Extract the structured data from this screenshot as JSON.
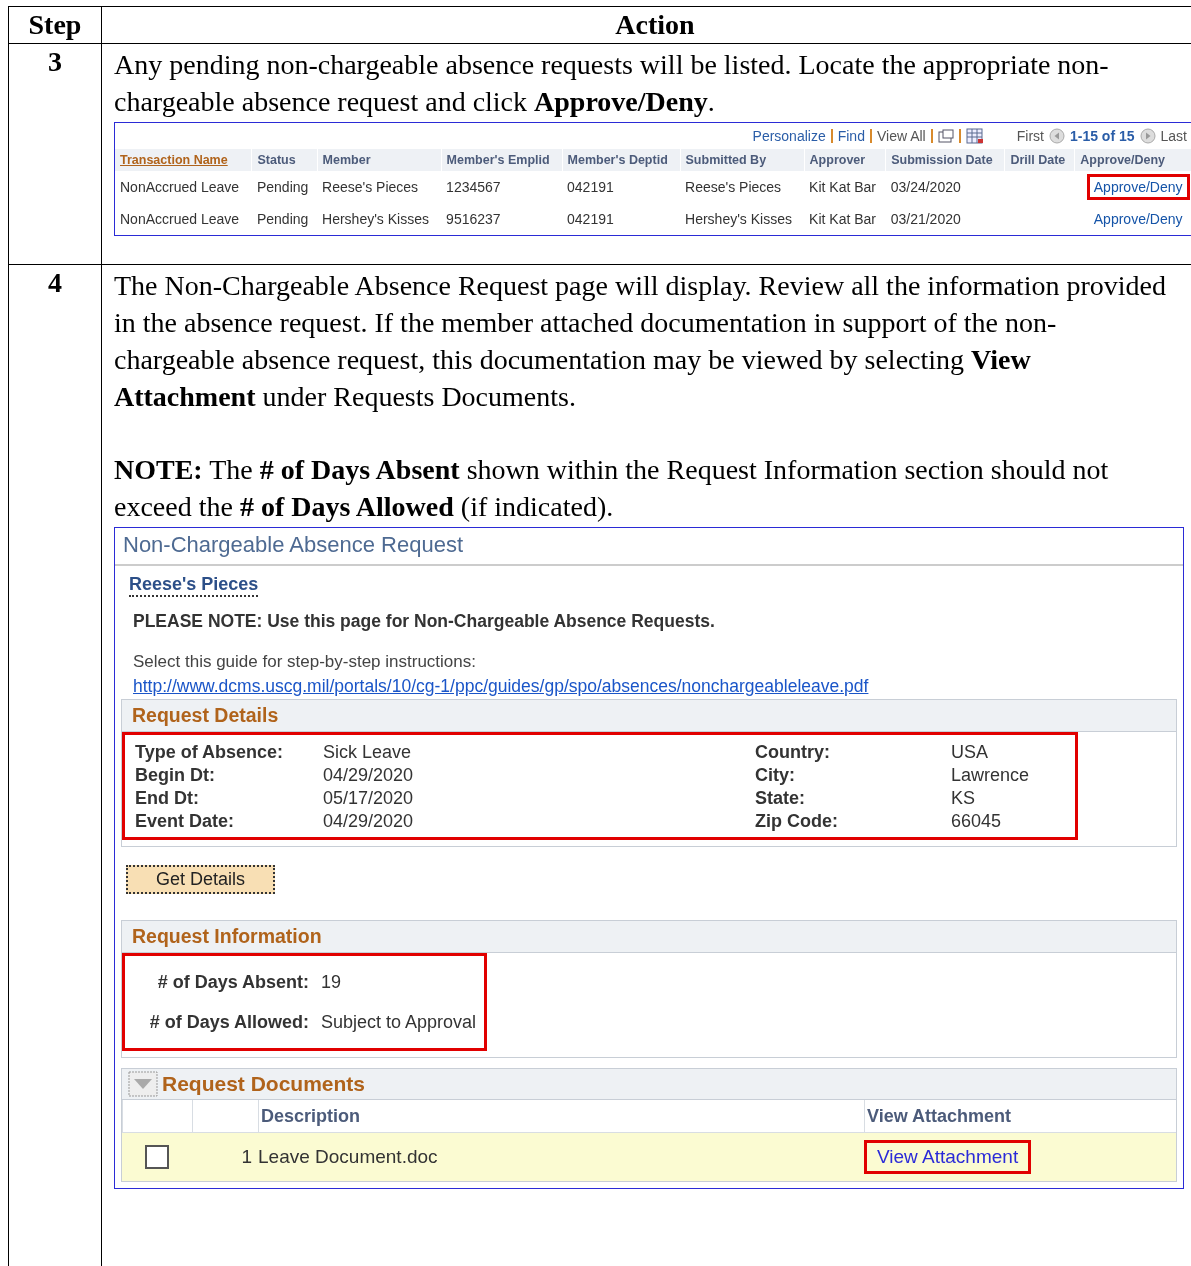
{
  "document_table": {
    "columns": [
      "Step",
      "Action"
    ]
  },
  "steps": [
    {
      "kind": "grid",
      "step": "3",
      "paragraphs": [
        "Any pending non-chargeable absence requests will be listed. Locate the appropriate non-chargeable absence request and click **Approve/Deny**."
      ],
      "grid": {
        "toolbar": {
          "personalize": "Personalize",
          "find": "Find",
          "view_all": "View All",
          "first": "First",
          "range": "1-15 of 15",
          "last": "Last"
        },
        "columns": [
          {
            "label": "Transaction Name",
            "sorted": true
          },
          {
            "label": "Status",
            "sorted": false
          },
          {
            "label": "Member",
            "sorted": false
          },
          {
            "label": "Member's Emplid",
            "sorted": false
          },
          {
            "label": "Member's Deptid",
            "sorted": false
          },
          {
            "label": "Submitted By",
            "sorted": false
          },
          {
            "label": "Approver",
            "sorted": false
          },
          {
            "label": "Submission Date",
            "sorted": false
          },
          {
            "label": "Drill Date",
            "sorted": false
          },
          {
            "label": "Approve/Deny",
            "sorted": false
          }
        ],
        "rows": [
          {
            "cells": [
              "NonAccrued Leave",
              "Pending",
              "Reese's Pieces",
              "1234567",
              "042191",
              "Reese's Pieces",
              "Kit Kat Bar",
              "03/24/2020",
              ""
            ],
            "action": "Approve/Deny",
            "highlighted": true
          },
          {
            "cells": [
              "NonAccrued Leave",
              "Pending",
              "Hershey's Kisses",
              "9516237",
              "042191",
              "Hershey's Kisses",
              "Kit Kat Bar",
              "03/21/2020",
              ""
            ],
            "action": "Approve/Deny",
            "highlighted": false
          }
        ]
      }
    },
    {
      "kind": "page",
      "step": "4",
      "paragraphs": [
        "The Non-Chargeable Absence Request page will display. Review all the information provided in the absence request. If the member attached documentation in support of the non-chargeable absence request, this documentation may be viewed by selecting **View Attachment** under Requests Documents.",
        "**NOTE:**  The **# of Days Absent** shown within the Request Information section should not exceed the **# of Days Allowed** (if indicated)."
      ],
      "page": {
        "title": "Non-Chargeable Absence Request",
        "member_name": "Reese's Pieces",
        "note": "PLEASE NOTE: Use this page for Non-Chargeable Absence Requests.",
        "guide_label": "Select this guide for step-by-step instructions:",
        "guide_link": "http://www.dcms.uscg.mil/portals/10/cg-1/ppc/guides/gp/spo/absences/nonchargeableleave.pdf",
        "request_details": {
          "title": "Request Details",
          "highlighted": true,
          "left_fields": [
            {
              "label": "Type of Absence:",
              "value": "Sick Leave"
            },
            {
              "label": "Begin Dt:",
              "value": "04/29/2020"
            },
            {
              "label": "End Dt:",
              "value": "05/17/2020"
            },
            {
              "label": "Event Date:",
              "value": "04/29/2020"
            }
          ],
          "right_fields": [
            {
              "label": "Country:",
              "value": "USA"
            },
            {
              "label": "City:",
              "value": "Lawrence"
            },
            {
              "label": "State:",
              "value": "KS"
            },
            {
              "label": "Zip Code:",
              "value": "66045"
            }
          ]
        },
        "get_details_button": "Get Details",
        "request_information": {
          "title": "Request Information",
          "highlighted": true,
          "fields": [
            {
              "label": "# of Days Absent:",
              "value": "19"
            },
            {
              "label": "# of Days Allowed:",
              "value": "Subject to Approval"
            }
          ]
        },
        "request_documents": {
          "title": "Request Documents",
          "expanded": true,
          "columns": [
            "Description",
            "View Attachment"
          ],
          "rows": [
            {
              "checked": false,
              "number": "1",
              "description": "Leave Document.doc",
              "link": "View Attachment",
              "highlighted": true
            }
          ]
        }
      }
    }
  ]
}
